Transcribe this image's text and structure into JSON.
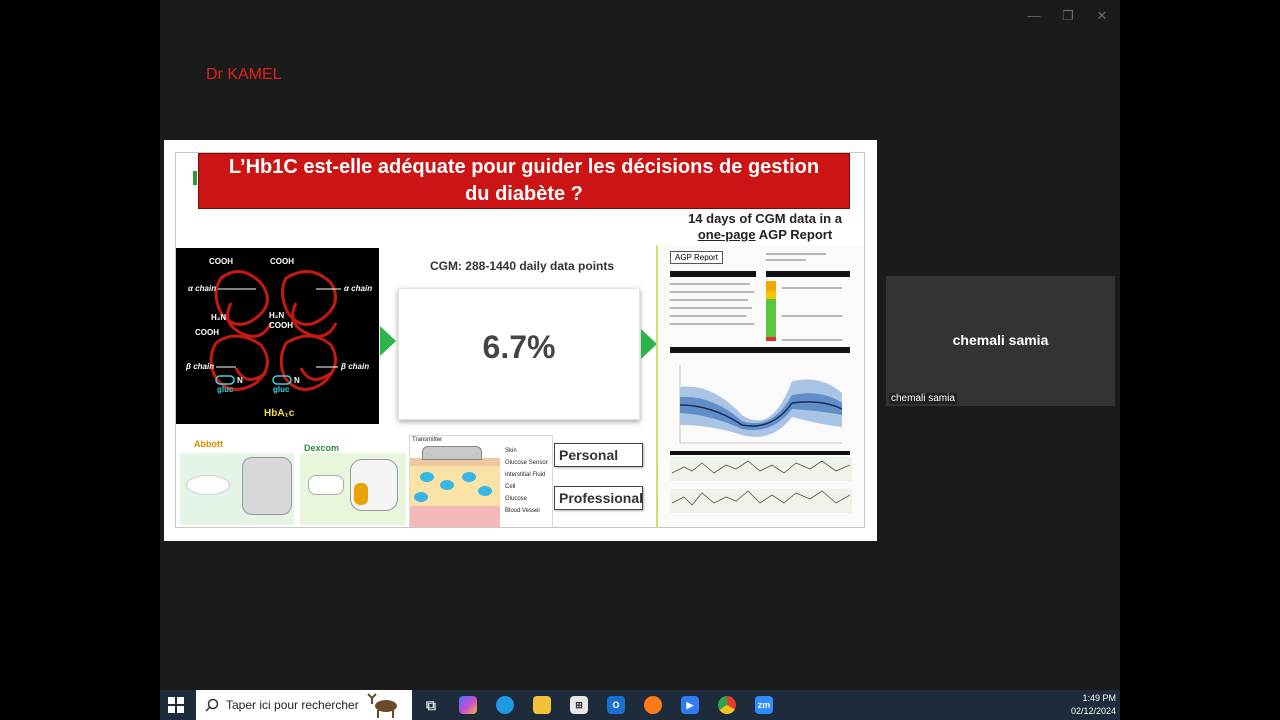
{
  "presenter": {
    "label": "Dr KAMEL"
  },
  "slide": {
    "title_line1": "L’Hb1C est-elle adéquate pour guider les décisions de gestion",
    "title_line2": "du diabète ?",
    "agp_caption_line1": "14 days of CGM data in a",
    "agp_caption_underline": "one-page",
    "agp_caption_rest": " AGP Report",
    "hba_labels": {
      "cooh_left": "COOH",
      "cooh_right": "COOH",
      "alpha_left": "α chain",
      "alpha_right": "α chain",
      "h2n_left": "H₂N",
      "h2n_mid": "H₂N",
      "cooh_mid_left": "COOH",
      "cooh_mid": "COOH",
      "beta_left": "β chain",
      "beta_right": "β chain",
      "n_left": "N",
      "n_right": "N",
      "gluc_left": "gluc",
      "gluc_right": "gluc",
      "hba_name": "HbA₁c"
    },
    "cgm_label": "CGM: 288-1440 daily data points",
    "cgm_value": "6.7%",
    "agp_report_title": "AGP Report",
    "brand_abbott": "Abbott",
    "brand_dexcom": "Dexcom",
    "diagram": {
      "transmitter": "Transmitter",
      "skin": "Skin",
      "sensor": "Glucose Sensor",
      "fluid": "Interstitial Fluid",
      "cell": "Cell",
      "glucose": "Glucose",
      "vessel": "Blood Vessel"
    },
    "personal": "Personal",
    "professional": "Professional"
  },
  "participant": {
    "name": "chemali samia",
    "tag": "chemali samia"
  },
  "taskbar": {
    "search_placeholder": "Taper ici pour rechercher",
    "time": "1:49 PM",
    "date": "02/12/2024",
    "zoom_label": "zm"
  },
  "colors": {
    "title_red": "#cc1414",
    "arrow_green": "#2cb34a",
    "presenter_red": "#e0201a"
  }
}
